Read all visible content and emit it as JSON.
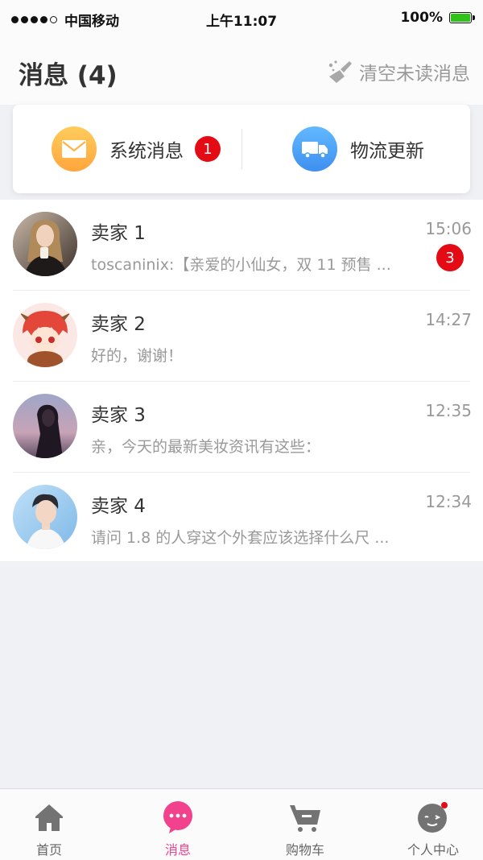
{
  "status_bar": {
    "carrier": "中国移动",
    "time": "上午11:07",
    "battery": "100%"
  },
  "header": {
    "title": "消息 (4)",
    "clear_label": "清空未读消息"
  },
  "quick": {
    "system": {
      "label": "系统消息",
      "badge": "1"
    },
    "logistics": {
      "label": "物流更新"
    }
  },
  "messages": [
    {
      "name": "卖家 1",
      "time": "15:06",
      "preview": "toscaninix:【亲爱的小仙女，双 11 预售 ...",
      "badge": "3"
    },
    {
      "name": "卖家 2",
      "time": "14:27",
      "preview": "好的，谢谢！",
      "badge": ""
    },
    {
      "name": "卖家 3",
      "time": "12:35",
      "preview": "亲，今天的最新美妆资讯有这些：",
      "badge": ""
    },
    {
      "name": "卖家 4",
      "time": "12:34",
      "preview": "请问 1.8 的人穿这个外套应该选择什么尺 ...",
      "badge": ""
    }
  ],
  "tabs": [
    {
      "label": "首页",
      "icon": "home-icon",
      "active": false
    },
    {
      "label": "消息",
      "icon": "chat-icon",
      "active": true
    },
    {
      "label": "购物车",
      "icon": "cart-icon",
      "active": false
    },
    {
      "label": "个人中心",
      "icon": "profile-icon",
      "active": false
    }
  ],
  "colors": {
    "accent": "#f2418d",
    "badge": "#e40b14",
    "battery": "#2fc21a"
  }
}
